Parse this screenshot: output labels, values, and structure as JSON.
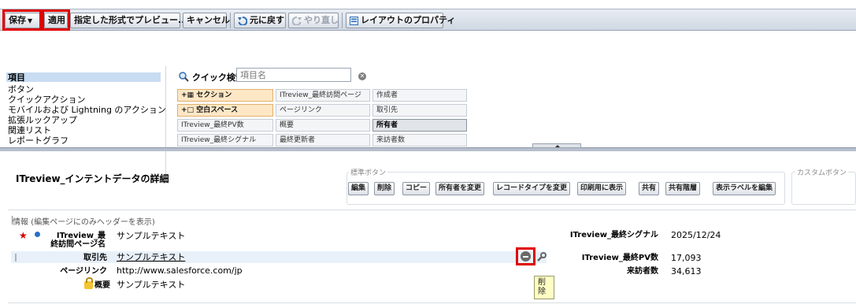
{
  "toolbar": {
    "save_label": "保存",
    "apply_label": "適用",
    "preview_label": "指定した形式でプレビュー...",
    "cancel_label": "キャンセル",
    "undo_label": "元に戻す",
    "redo_label": "やり直し",
    "layout_props_label": "レイアウトのプロパティ"
  },
  "palette": {
    "categories": [
      {
        "label": "項目",
        "active": true
      },
      {
        "label": "ボタン"
      },
      {
        "label": "クイックアクション"
      },
      {
        "label": "モバイルおよび Lightning のアクション"
      },
      {
        "label": "拡張ルックアップ"
      },
      {
        "label": "関連リスト"
      },
      {
        "label": "レポートグラフ"
      }
    ],
    "quick_search_label": "クイック検索",
    "quick_search_placeholder": "項目名",
    "fields": [
      "セクション",
      "ITreview_最終訪問ページ",
      "作成者",
      "空白スペース",
      "ページリンク",
      "取引先",
      "ITreview_最終PV数",
      "概要",
      "所有者",
      "ITreview_最終シグナル",
      "最終更新者",
      "来訪者数"
    ]
  },
  "detail": {
    "title": "ITreview_インテントデータの詳細",
    "standard_buttons_label": "標準ボタン",
    "custom_buttons_label": "カスタムボタン",
    "standard_buttons": [
      "編集",
      "削除",
      "コピー",
      "所有者を変更",
      "レコードタイプを変更",
      "印刷用に表示",
      "共有",
      "共有階層",
      "表示ラベルを編集"
    ],
    "section_header": "情報 (編集ページにのみヘッダーを表示)",
    "left_fields": [
      {
        "label": "ITreview_最終訪問ページ名",
        "value": "サンプルテキスト"
      },
      {
        "label": "取引先",
        "value": "サンプルテキスト"
      },
      {
        "label": "ページリンク",
        "value": "http://www.salesforce.com/jp"
      },
      {
        "label": "概要",
        "value": "サンプルテキスト"
      }
    ],
    "right_fields": [
      {
        "label": "ITreview_最終シグナル",
        "value": "2025/12/24"
      },
      {
        "label": "ITreview_最終PV数",
        "value": "17,093"
      },
      {
        "label": "来訪者数",
        "value": "34,613"
      }
    ],
    "tooltip": "削除"
  },
  "colors": {
    "highlight": "#e00000",
    "link_blue": "#2a6fcb",
    "special_field_bg": "#fde7c5",
    "row_highlight": "#e8f1fa"
  }
}
